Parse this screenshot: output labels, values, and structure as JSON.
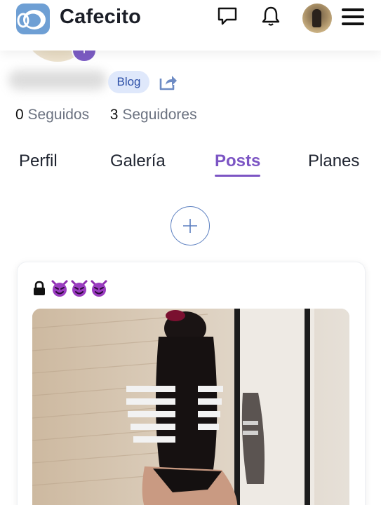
{
  "header": {
    "brand": "Cafecito",
    "icons": [
      "logo-icon",
      "chat-icon",
      "bell-icon",
      "user-avatar",
      "menu-icon"
    ]
  },
  "profile": {
    "badge": "Blog",
    "following_count": "0",
    "following_label": "Seguidos",
    "followers_count": "3",
    "followers_label": "Seguidores"
  },
  "tabs": [
    {
      "label": "Perfil",
      "active": false
    },
    {
      "label": "Galería",
      "active": false
    },
    {
      "label": "Posts",
      "active": true
    },
    {
      "label": "Planes",
      "active": false
    }
  ],
  "post": {
    "title_emojis": "😈😈😈",
    "locked": true
  },
  "colors": {
    "accent": "#7c55c4",
    "badge_bg": "#dfe8fb",
    "badge_text": "#2c4fa7",
    "add_border": "#5b7fc0"
  }
}
